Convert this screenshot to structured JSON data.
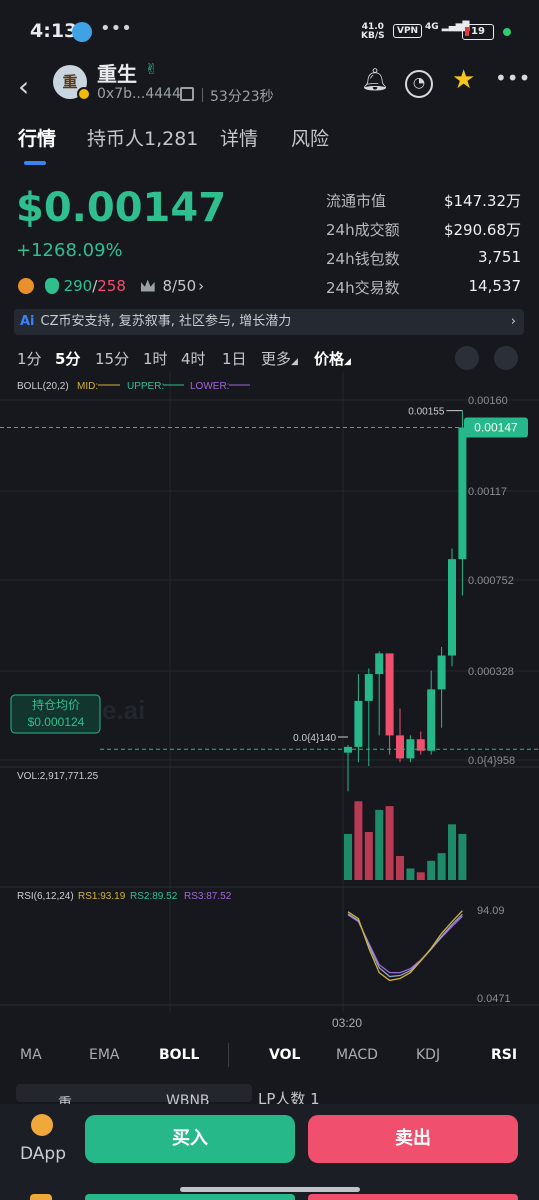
{
  "status_bar": {
    "time": "4:13",
    "more": "•••",
    "net_speed": "41.0",
    "net_unit": "KB/S",
    "vpn": "VPN",
    "signal": "4G",
    "battery": "19"
  },
  "header": {
    "avatar_char": "重",
    "token_name": "重生",
    "address": "0x7b...4444",
    "age": "53分23秒",
    "icons": [
      "bell-icon",
      "gauge-icon",
      "star-icon",
      "more-icon"
    ]
  },
  "tabs": [
    {
      "label": "行情",
      "active": true
    },
    {
      "label": "持币人1,281",
      "active": false
    },
    {
      "label": "详情",
      "active": false
    },
    {
      "label": "风险",
      "active": false
    }
  ],
  "price": {
    "value": "$0.00147",
    "change": "+1268.09%",
    "buys": "290",
    "slash": "/",
    "sells": "258",
    "rank": "8/50",
    "rank_chev": "›"
  },
  "stats": [
    {
      "label": "流通市值",
      "value": "$147.32万"
    },
    {
      "label": "24h成交额",
      "value": "$290.68万"
    },
    {
      "label": "24h钱包数",
      "value": "3,751"
    },
    {
      "label": "24h交易数",
      "value": "14,537"
    }
  ],
  "ai_bar": {
    "badge": "Ai",
    "text": "CZ币安支持, 复苏叙事, 社区参与, 增长潜力",
    "chev": "›"
  },
  "intervals": [
    {
      "label": "1分",
      "active": false
    },
    {
      "label": "5分",
      "active": true
    },
    {
      "label": "15分",
      "active": false
    },
    {
      "label": "1时",
      "active": false
    },
    {
      "label": "4时",
      "active": false
    },
    {
      "label": "1日",
      "active": false
    },
    {
      "label": "更多",
      "active": false
    },
    {
      "label": "价格",
      "active": true
    }
  ],
  "chart_data": {
    "type": "candlestick",
    "indicator_labels": {
      "boll": "BOLL(20,2)",
      "mid": "MID:",
      "upper": "UPPER:",
      "lower": "LOWER:",
      "vol": "VOL:2,917,771.25",
      "rsi": "RSI(6,12,24)",
      "rs1": "RS1:93.19",
      "rs2": "RS2:89.52",
      "rs3": "RS3:87.52"
    },
    "y_ticks": [
      "0.00160",
      "0.00117",
      "0.000752",
      "0.000328",
      "0.0{4}958"
    ],
    "y_tick_values": [
      0.0016,
      0.00117,
      0.000752,
      0.000328,
      9.58e-05
    ],
    "ylim": [
      9.58e-05,
      0.0016
    ],
    "current_price_label": "0.00147",
    "current_price": 0.00147,
    "high_label": "0.00155",
    "high": 0.00155,
    "low_label": "0.0{4}140",
    "low": 1.4e-05,
    "avg_cost_title": "持仓均价",
    "avg_cost_value": "$0.000124",
    "avg_cost": 0.000124,
    "watermark": "e.ai",
    "candles": [
      {
        "o": 0.000115,
        "h": 0.000135,
        "l": 1.4e-05,
        "c": 0.00013
      },
      {
        "o": 0.00013,
        "h": 0.00032,
        "l": 9e-05,
        "c": 0.00025
      },
      {
        "o": 0.00025,
        "h": 0.00034,
        "l": 8e-05,
        "c": 0.00032
      },
      {
        "o": 0.00032,
        "h": 0.00042,
        "l": 0.00016,
        "c": 0.00041
      },
      {
        "o": 0.00041,
        "h": 0.00041,
        "l": 0.00011,
        "c": 0.00016
      },
      {
        "o": 0.00016,
        "h": 0.00023,
        "l": 9e-05,
        "c": 0.0001
      },
      {
        "o": 0.0001,
        "h": 0.00016,
        "l": 9e-05,
        "c": 0.00015
      },
      {
        "o": 0.00015,
        "h": 0.00017,
        "l": 0.00011,
        "c": 0.00012
      },
      {
        "o": 0.00012,
        "h": 0.00033,
        "l": 0.00011,
        "c": 0.00028
      },
      {
        "o": 0.00028,
        "h": 0.00044,
        "l": 0.00018,
        "c": 0.0004
      },
      {
        "o": 0.0004,
        "h": 0.0009,
        "l": 0.00035,
        "c": 0.00085
      },
      {
        "o": 0.00085,
        "h": 0.00155,
        "l": 0.00068,
        "c": 0.00147
      }
    ],
    "volumes": [
      0,
      0,
      0,
      0,
      0,
      0,
      0,
      0,
      0,
      0,
      0,
      0
    ],
    "volume_bars": [
      {
        "v": 0.48,
        "up": true
      },
      {
        "v": 0.82,
        "up": false
      },
      {
        "v": 0.5,
        "up": false
      },
      {
        "v": 0.73,
        "up": true
      },
      {
        "v": 0.77,
        "up": false
      },
      {
        "v": 0.25,
        "up": false
      },
      {
        "v": 0.12,
        "up": true
      },
      {
        "v": 0.08,
        "up": false
      },
      {
        "v": 0.2,
        "up": true
      },
      {
        "v": 0.28,
        "up": true
      },
      {
        "v": 0.58,
        "up": true
      },
      {
        "v": 0.48,
        "up": true
      }
    ],
    "rsi_ticks": [
      "94.09",
      "0.0471"
    ],
    "rsi": {
      "rs1": [
        92,
        85,
        55,
        30,
        22,
        24,
        30,
        42,
        55,
        70,
        82,
        93.19
      ],
      "rs2": [
        90,
        83,
        58,
        35,
        26,
        27,
        32,
        42,
        54,
        67,
        79,
        89.52
      ],
      "rs3": [
        89,
        82,
        60,
        38,
        30,
        30,
        34,
        43,
        54,
        66,
        77,
        87.52
      ]
    },
    "x_label": "03:20",
    "colors": {
      "up": "#26b889",
      "down": "#f0506e",
      "mid": "#d4b13a",
      "upper": "#2fbf8f",
      "lower": "#a066d8"
    }
  },
  "indicators": {
    "main": [
      {
        "label": "MA",
        "active": false
      },
      {
        "label": "EMA",
        "active": false
      },
      {
        "label": "BOLL",
        "active": true
      }
    ],
    "sub": [
      {
        "label": "VOL",
        "active": true
      },
      {
        "label": "MACD",
        "active": false
      },
      {
        "label": "KDJ",
        "active": false
      },
      {
        "label": "RSI",
        "active": true
      }
    ]
  },
  "peek": {
    "pair_a": "重生",
    "pair_b": "WBNB",
    "lp": "LP人数 1"
  },
  "actions": {
    "dapp": "DApp",
    "buy": "买入",
    "sell": "卖出"
  }
}
